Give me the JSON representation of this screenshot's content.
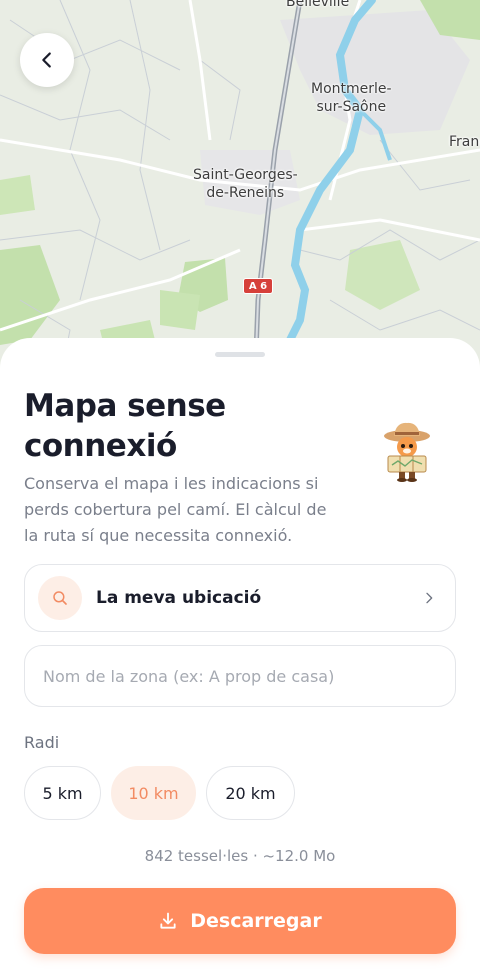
{
  "map": {
    "labels": {
      "belleville": "Belleville",
      "montmerle": "Montmerle-\nsur-Saône",
      "saint_georges": "Saint-Georges-\nde-Reneins",
      "france_partial": "Franc"
    },
    "road_badge": "A 6"
  },
  "icons": {
    "back": "chevron-left-icon",
    "search": "search-icon",
    "chevron": "chevron-right-icon",
    "download": "download-icon"
  },
  "sheet": {
    "title": "Mapa sense connexió",
    "description": "Conserva el mapa i les indicacions si perds cobertura pel camí. El càlcul de la ruta sí que necessita connexió.",
    "location": {
      "label": "La meva ubicació"
    },
    "zone_input": {
      "value": "",
      "placeholder": "Nom de la zona (ex: A prop de casa)"
    },
    "radius": {
      "label": "Radi",
      "options": [
        "5 km",
        "10 km",
        "20 km"
      ],
      "selected": "10 km"
    },
    "tiles_info": "842 tessel·les · ~12.0 Mo",
    "download_label": "Descarregar"
  },
  "colors": {
    "accent": "#ff8c5f",
    "accent_soft": "#fdeee6",
    "title": "#1a1d2b",
    "muted": "#7a7f8b",
    "river": "#8fd0ea",
    "forest": "#bfe0a8"
  }
}
